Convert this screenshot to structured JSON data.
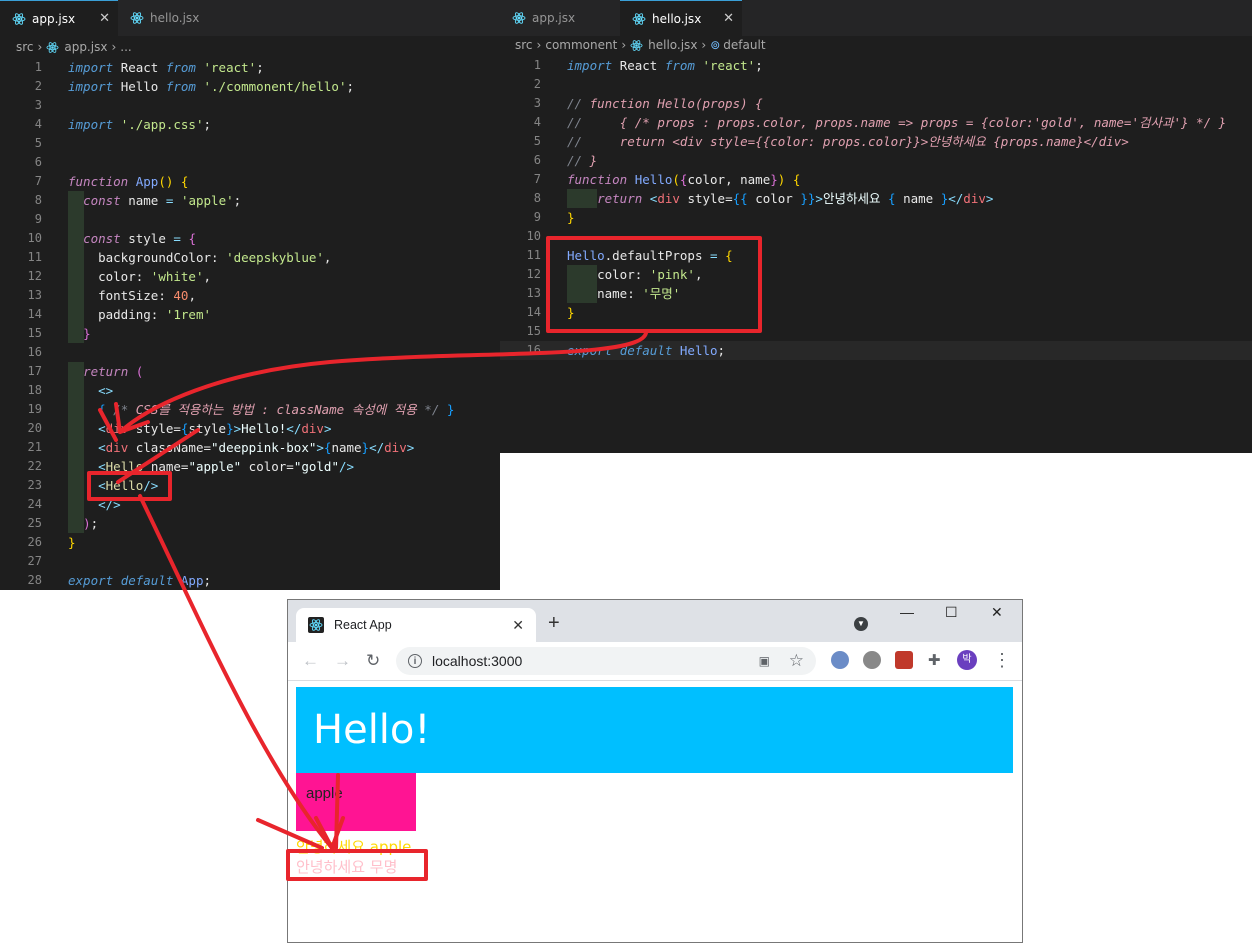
{
  "left_editor": {
    "tabs": [
      {
        "label": "app.jsx",
        "active": true,
        "close": "✕"
      },
      {
        "label": "hello.jsx",
        "active": false
      }
    ],
    "breadcrumb": [
      "src",
      "app.jsx",
      "..."
    ],
    "lines": [
      {
        "n": "1",
        "html": "<span class='kb'>import</span> <span class='pr'>React</span> <span class='kb'>from</span> <span class='str'>'react'</span><span class='pr'>;</span>"
      },
      {
        "n": "2",
        "html": "<span class='kb'>import</span> <span class='pr'>Hello</span> <span class='kb'>from</span> <span class='str'>'./commonent/hello'</span><span class='pr'>;</span>"
      },
      {
        "n": "3",
        "html": ""
      },
      {
        "n": "4",
        "html": "<span class='kb'>import</span> <span class='str'>'./app.css'</span><span class='pr'>;</span>"
      },
      {
        "n": "5",
        "html": ""
      },
      {
        "n": "6",
        "html": ""
      },
      {
        "n": "7",
        "html": "<span class='kw'>function</span> <span class='cls'>App</span><span class='brk'>()</span> <span class='brk'>{</span>"
      },
      {
        "n": "8",
        "html": "  <span class='kw'>const</span> <span class='pr'>name</span> <span class='punc'>=</span> <span class='str'>'apple'</span><span class='pr'>;</span>"
      },
      {
        "n": "9",
        "html": ""
      },
      {
        "n": "10",
        "html": "  <span class='kw'>const</span> <span class='pr'>style</span> <span class='punc'>=</span> <span class='brk2'>{</span>"
      },
      {
        "n": "11",
        "html": "    <span class='pr'>backgroundColor:</span> <span class='str'>'deepskyblue'</span><span class='pr'>,</span>"
      },
      {
        "n": "12",
        "html": "    <span class='pr'>color:</span> <span class='str'>'white'</span><span class='pr'>,</span>"
      },
      {
        "n": "13",
        "html": "    <span class='pr'>fontSize:</span> <span class='num'>40</span><span class='pr'>,</span>"
      },
      {
        "n": "14",
        "html": "    <span class='pr'>padding:</span> <span class='str'>'1rem'</span>"
      },
      {
        "n": "15",
        "html": "  <span class='brk2'>}</span>"
      },
      {
        "n": "16",
        "html": ""
      },
      {
        "n": "17",
        "html": "  <span class='kw'>return</span> <span class='brk2'>(</span>"
      },
      {
        "n": "18",
        "html": "    <span class='punc'>&lt;&gt;</span>"
      },
      {
        "n": "19",
        "html": "    <span class='brk3'>{</span> <span class='cm'>/*</span> <span class='cmw'>CSS를 적용하는 방법 : className 속성에 적용</span> <span class='cm'>*/</span> <span class='brk3'>}</span>"
      },
      {
        "n": "20",
        "html": "    <span class='punc'>&lt;</span><span class='tag'>div</span> <span class='pr'>style=</span><span class='brk3'>{</span><span class='pr'>style</span><span class='brk3'>}</span><span class='punc'>&gt;</span><span class='white'>Hello!</span><span class='punc'>&lt;/</span><span class='tag'>div</span><span class='punc'>&gt;</span>"
      },
      {
        "n": "21",
        "html": "    <span class='punc'>&lt;</span><span class='tag'>div</span> <span class='pr'>className=</span><span class='white'>\"deeppink-box\"</span><span class='punc'>&gt;</span><span class='brk3'>{</span><span class='pr'>name</span><span class='brk3'>}</span><span class='punc'>&lt;/</span><span class='tag'>div</span><span class='punc'>&gt;</span>"
      },
      {
        "n": "22",
        "html": "    <span class='punc'>&lt;</span><span class='fn'>Hello</span> <span class='pr'>name=</span><span class='white'>\"apple\"</span> <span class='pr'>color=</span><span class='white'>\"gold\"</span><span class='punc'>/&gt;</span>"
      },
      {
        "n": "23",
        "html": "    <span class='punc'>&lt;</span><span class='fn'>Hello</span><span class='punc'>/&gt;</span>"
      },
      {
        "n": "24",
        "html": "    <span class='punc'>&lt;/&gt;</span>"
      },
      {
        "n": "25",
        "html": "  <span class='brk2'>)</span><span class='pr'>;</span>"
      },
      {
        "n": "26",
        "html": "<span class='brk'>}</span>"
      },
      {
        "n": "27",
        "html": ""
      },
      {
        "n": "28",
        "html": "<span class='kb'>export</span> <span class='kb'>default</span> <span class='cls'>App</span><span class='pr'>;</span>"
      }
    ]
  },
  "right_editor": {
    "tabs": [
      {
        "label": "app.jsx",
        "active": false
      },
      {
        "label": "hello.jsx",
        "active": true,
        "close": "✕"
      }
    ],
    "breadcrumb": [
      "src",
      "commonent",
      "hello.jsx",
      "default"
    ],
    "lines": [
      {
        "n": "1",
        "html": "<span class='kb'>import</span> <span class='pr'>React</span> <span class='kb'>from</span> <span class='str'>'react'</span><span class='pr'>;</span>"
      },
      {
        "n": "2",
        "html": ""
      },
      {
        "n": "3",
        "html": "<span class='cm'>//</span> <span class='cmw'>function Hello(props) {</span>"
      },
      {
        "n": "4",
        "html": "<span class='cm'>//</span>     <span class='cmw'>{ /* props : props.color, props.name =&gt; props = {color:'gold', name='검사과'} */ }</span>"
      },
      {
        "n": "5",
        "html": "<span class='cm'>//</span>     <span class='cmw'>return &lt;div style={{color: props.color}}&gt;안녕하세요 {props.name}&lt;/div&gt;</span>"
      },
      {
        "n": "6",
        "html": "<span class='cm'>//</span> <span class='cmw'>}</span>"
      },
      {
        "n": "7",
        "html": "<span class='kw'>function</span> <span class='cls'>Hello</span><span class='brk'>(</span><span class='brk2'>{</span><span class='pr'>color, name</span><span class='brk2'>}</span><span class='brk'>)</span> <span class='brk'>{</span>"
      },
      {
        "n": "8",
        "html": "    <span class='kw'>return</span> <span class='punc'>&lt;</span><span class='tag'>div</span> <span class='pr'>style=</span><span class='brk3'>{{</span> <span class='pr'>color</span> <span class='brk3'>}}</span><span class='punc'>&gt;</span><span class='white'>안녕하세요</span> <span class='brk3'>{</span> <span class='pr'>name</span> <span class='brk3'>}</span><span class='punc'>&lt;/</span><span class='tag'>div</span><span class='punc'>&gt;</span>"
      },
      {
        "n": "9",
        "html": "<span class='brk'>}</span>"
      },
      {
        "n": "10",
        "html": ""
      },
      {
        "n": "11",
        "html": "<span class='cls'>Hello</span><span class='pr'>.defaultProps</span> <span class='punc'>=</span> <span class='brk'>{</span>"
      },
      {
        "n": "12",
        "html": "    <span class='pr'>color:</span> <span class='str'>'pink'</span><span class='pr'>,</span>"
      },
      {
        "n": "13",
        "html": "    <span class='pr'>name:</span> <span class='str'>'무명'</span>"
      },
      {
        "n": "14",
        "html": "<span class='brk'>}</span>"
      },
      {
        "n": "15",
        "html": ""
      },
      {
        "n": "16",
        "html": "<span class='kb'>export</span> <span class='kb'>default</span> <span class='cls'>Hello</span><span class='pr'>;</span>"
      }
    ]
  },
  "browser": {
    "tab_title": "React App",
    "tab_close": "✕",
    "new_tab": "+",
    "url": "localhost:3000",
    "win_min": "—",
    "win_max": "☐",
    "win_close": "✕",
    "back": "←",
    "forward": "→",
    "reload": "↻",
    "star": "☆",
    "menu": "⋮",
    "profile_initial": "박",
    "hello_text": "Hello!",
    "pink_box_text": "apple",
    "gold_line": "안녕하세요 apple",
    "pink_line": "안녕하세요 무명",
    "colors": {
      "sky": "#00bfff",
      "deeppink": "#ff1493",
      "gold": "#ffd700",
      "pink": "#ffc0cb"
    }
  },
  "annotation_color": "#e8252c"
}
